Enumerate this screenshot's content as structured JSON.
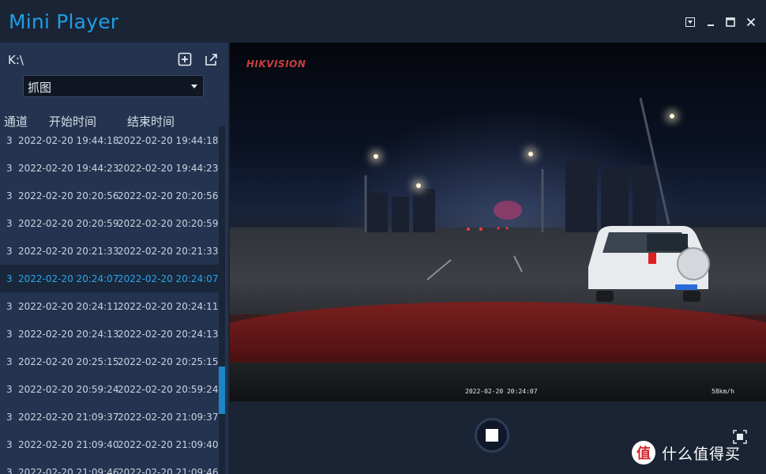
{
  "app": {
    "title": "Mini Player"
  },
  "window_controls": [
    "menu-down",
    "minimize",
    "maximize",
    "close"
  ],
  "sidebar": {
    "path": "K:\\",
    "capture_mode": {
      "selected": "抓图"
    },
    "columns": {
      "channel": "通道",
      "start": "开始时间",
      "end": "结束时间"
    },
    "rows": [
      {
        "channel": "3",
        "start": "2022-02-20 19:44:18",
        "end": "2022-02-20 19:44:18",
        "selected": false
      },
      {
        "channel": "3",
        "start": "2022-02-20 19:44:23",
        "end": "2022-02-20 19:44:23",
        "selected": false
      },
      {
        "channel": "3",
        "start": "2022-02-20 20:20:56",
        "end": "2022-02-20 20:20:56",
        "selected": false
      },
      {
        "channel": "3",
        "start": "2022-02-20 20:20:59",
        "end": "2022-02-20 20:20:59",
        "selected": false
      },
      {
        "channel": "3",
        "start": "2022-02-20 20:21:33",
        "end": "2022-02-20 20:21:33",
        "selected": false
      },
      {
        "channel": "3",
        "start": "2022-02-20 20:24:07",
        "end": "2022-02-20 20:24:07",
        "selected": true
      },
      {
        "channel": "3",
        "start": "2022-02-20 20:24:11",
        "end": "2022-02-20 20:24:11",
        "selected": false
      },
      {
        "channel": "3",
        "start": "2022-02-20 20:24:13",
        "end": "2022-02-20 20:24:13",
        "selected": false
      },
      {
        "channel": "3",
        "start": "2022-02-20 20:25:15",
        "end": "2022-02-20 20:25:15",
        "selected": false
      },
      {
        "channel": "3",
        "start": "2022-02-20 20:59:24",
        "end": "2022-02-20 20:59:24",
        "selected": false
      },
      {
        "channel": "3",
        "start": "2022-02-20 21:09:37",
        "end": "2022-02-20 21:09:37",
        "selected": false
      },
      {
        "channel": "3",
        "start": "2022-02-20 21:09:40",
        "end": "2022-02-20 21:09:40",
        "selected": false
      },
      {
        "channel": "3",
        "start": "2022-02-20 21:09:46",
        "end": "2022-02-20 21:09:46",
        "selected": false
      }
    ]
  },
  "video": {
    "watermark": "HIKVISION",
    "osd_timestamp": "2022-02-20 20:24:07",
    "osd_speed": "58km/h"
  },
  "brand": {
    "logo": "值",
    "text": "什么值得买"
  },
  "colors": {
    "accent": "#1e9ee8",
    "selected_text": "#2aa6ee",
    "sidebar_bg": "#243450",
    "window_bg": "#1b2434"
  }
}
